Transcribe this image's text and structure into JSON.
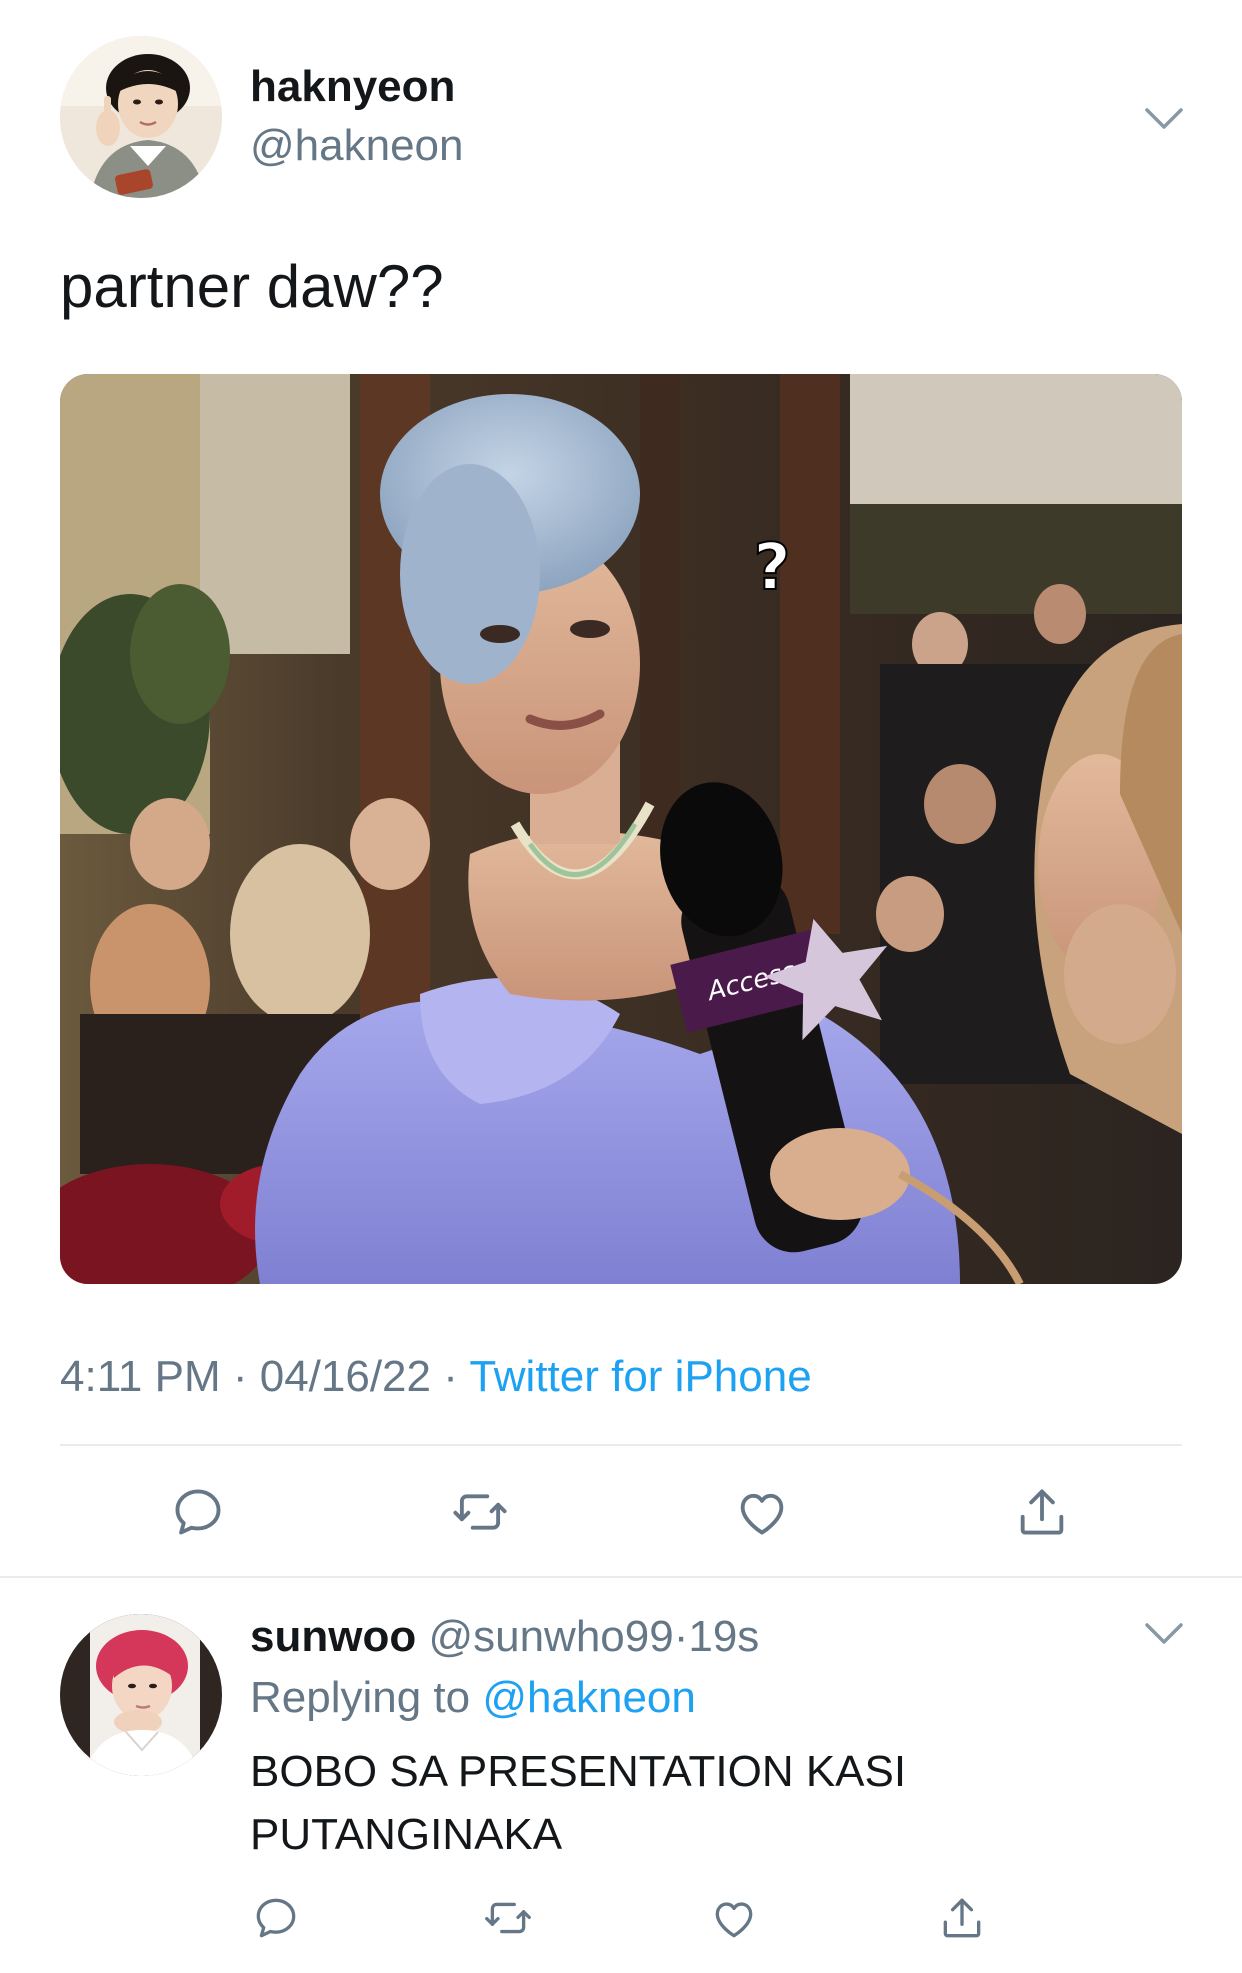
{
  "main_tweet": {
    "author": {
      "display_name": "haknyeon",
      "handle": "@hakneon"
    },
    "text": "partner daw??",
    "media": {
      "overlay_text": "?",
      "mic_label": "Access"
    },
    "meta": {
      "time": "4:11 PM",
      "separator": " · ",
      "date": "04/16/22",
      "source": "Twitter for iPhone"
    },
    "actions": [
      "reply-icon",
      "retweet-icon",
      "like-icon",
      "share-icon"
    ]
  },
  "reply_tweet": {
    "author": {
      "display_name": "sunwoo",
      "handle": "@sunwho99",
      "time": "19s"
    },
    "time_separator": "·",
    "replying_label": "Replying to",
    "replying_to": "@hakneon",
    "text_lines": [
      "BOBO SA PRESENTATION KASI",
      "PUTANGINAKA"
    ],
    "actions": [
      "reply-icon",
      "retweet-icon",
      "like-icon",
      "share-icon"
    ]
  },
  "colors": {
    "link": "#1da1f2",
    "secondary_text": "#657786",
    "primary_text": "#14171a",
    "divider": "#e6ecf0",
    "icon": "#657786"
  }
}
